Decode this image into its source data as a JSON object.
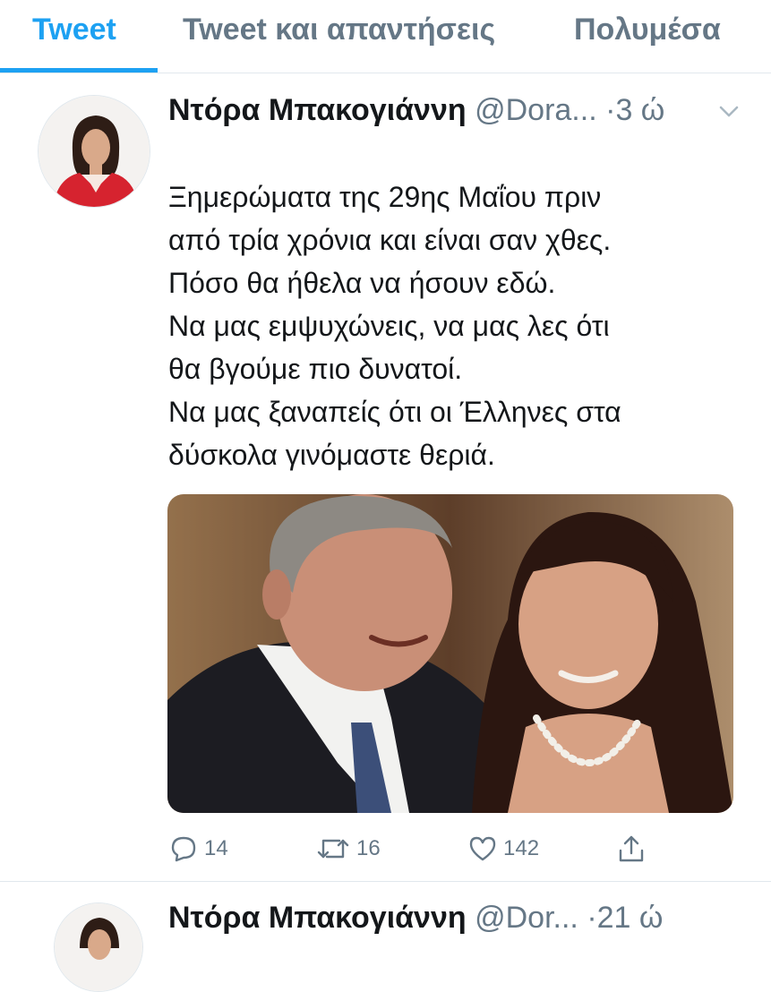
{
  "tabs": [
    {
      "label": "Tweet",
      "active": true
    },
    {
      "label": "Tweet και απαντήσεις",
      "active": false
    },
    {
      "label": "Πολυμέσα",
      "active": false
    }
  ],
  "tweet": {
    "author_name": "Ντόρα Μπακογιάννη",
    "handle": "@Dora...",
    "separator": "·",
    "time": "3 ώ",
    "text_lines": [
      "Ξημερώματα της 29ης Μαΐου πριν",
      "από τρία χρόνια και είναι σαν χθες.",
      "Πόσο θα ήθελα να ήσουν εδώ.",
      "Να μας εμψυχώνεις, να μας λες ότι",
      "θα βγούμε πιο δυνατοί.",
      "Να μας ξαναπείς ότι οι Έλληνες στα",
      "δύσκολα γινόμαστε θεριά."
    ],
    "actions": {
      "replies": "14",
      "retweets": "16",
      "likes": "142"
    }
  },
  "next_tweet": {
    "author_name": "Ντόρα Μπακογιάννη",
    "handle": "@Dor...",
    "separator": "·",
    "time": "21 ώ"
  },
  "icons": {
    "reply": "reply-icon",
    "retweet": "retweet-icon",
    "like": "heart-icon",
    "share": "share-icon",
    "menu": "chevron-down-icon"
  },
  "colors": {
    "accent": "#1da1f2",
    "text": "#14171a",
    "secondary": "#657786",
    "border": "#e1e8ed"
  }
}
